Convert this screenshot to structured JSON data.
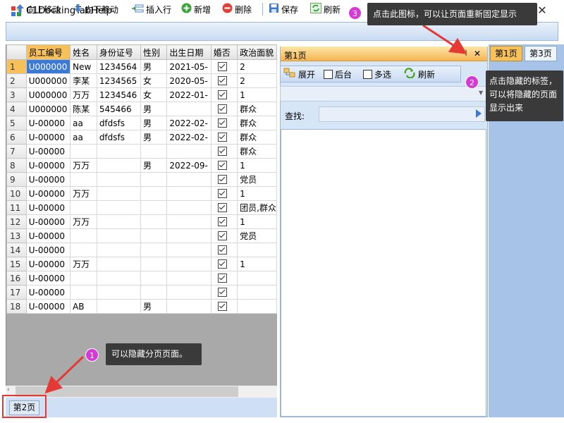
{
  "window": {
    "title": "C1DockingTabHelp"
  },
  "toolbar": {
    "items": [
      {
        "label": "向上移动",
        "icon": "arrow-up-icon"
      },
      {
        "label": "向下移动",
        "icon": "arrow-down-icon"
      },
      {
        "label": "插入行",
        "icon": "insert-row-icon"
      },
      {
        "label": "新增",
        "icon": "add-icon"
      },
      {
        "label": "删除",
        "icon": "delete-icon"
      },
      {
        "label": "保存",
        "icon": "save-icon"
      },
      {
        "label": "刷新",
        "icon": "refresh-icon"
      }
    ]
  },
  "grid": {
    "columns": [
      "员工编号",
      "姓名",
      "身份证号",
      "性别",
      "出生日期",
      "婚否",
      "政治面貌"
    ],
    "rows": [
      {
        "n": "1",
        "id": "U000000",
        "name": "New",
        "idcard": "1234564",
        "gender": "男",
        "birth": "2021-05-",
        "married": true,
        "political": "2"
      },
      {
        "n": "2",
        "id": "U000000",
        "name": "李某",
        "idcard": "1234565",
        "gender": "女",
        "birth": "2020-05-",
        "married": true,
        "political": "2"
      },
      {
        "n": "3",
        "id": "U000000",
        "name": "万万",
        "idcard": "1234546",
        "gender": "女",
        "birth": "2022-01-",
        "married": true,
        "political": "1"
      },
      {
        "n": "4",
        "id": "U000000",
        "name": "陈某",
        "idcard": "545466",
        "gender": "男",
        "birth": "",
        "married": true,
        "political": "群众"
      },
      {
        "n": "5",
        "id": "U-00000",
        "name": "aa",
        "idcard": "dfdsfs",
        "gender": "男",
        "birth": "2022-02-",
        "married": true,
        "political": "群众"
      },
      {
        "n": "6",
        "id": "U-00000",
        "name": "aa",
        "idcard": "dfdsfs",
        "gender": "男",
        "birth": "2022-02-",
        "married": true,
        "political": "群众"
      },
      {
        "n": "7",
        "id": "U-00000",
        "name": "",
        "idcard": "",
        "gender": "",
        "birth": "",
        "married": true,
        "political": "群众"
      },
      {
        "n": "8",
        "id": "U-00000",
        "name": "万万",
        "idcard": "",
        "gender": "男",
        "birth": "2022-09-",
        "married": true,
        "political": "1"
      },
      {
        "n": "9",
        "id": "U-00000",
        "name": "",
        "idcard": "",
        "gender": "",
        "birth": "",
        "married": true,
        "political": "党员"
      },
      {
        "n": "10",
        "id": "U-00000",
        "name": "万万",
        "idcard": "",
        "gender": "",
        "birth": "",
        "married": true,
        "political": "1"
      },
      {
        "n": "11",
        "id": "U-00000",
        "name": "",
        "idcard": "",
        "gender": "",
        "birth": "",
        "married": true,
        "political": "团员,群众"
      },
      {
        "n": "12",
        "id": "U-00000",
        "name": "万万",
        "idcard": "",
        "gender": "",
        "birth": "",
        "married": true,
        "political": "1"
      },
      {
        "n": "13",
        "id": "U-00000",
        "name": "",
        "idcard": "",
        "gender": "",
        "birth": "",
        "married": true,
        "political": "党员"
      },
      {
        "n": "14",
        "id": "U-00000",
        "name": "",
        "idcard": "",
        "gender": "",
        "birth": "",
        "married": true,
        "political": ""
      },
      {
        "n": "15",
        "id": "U-00000",
        "name": "万万",
        "idcard": "",
        "gender": "",
        "birth": "",
        "married": true,
        "political": "1"
      },
      {
        "n": "16",
        "id": "U-00000",
        "name": "",
        "idcard": "",
        "gender": "",
        "birth": "",
        "married": true,
        "political": ""
      },
      {
        "n": "17",
        "id": "U-00000",
        "name": "",
        "idcard": "",
        "gender": "",
        "birth": "",
        "married": true,
        "political": ""
      },
      {
        "n": "18",
        "id": "U-00000",
        "name": "AB",
        "idcard": "",
        "gender": "男",
        "birth": "",
        "married": true,
        "political": ""
      }
    ]
  },
  "bottom_tab": {
    "label": "第2页"
  },
  "dock": {
    "caption": "第1页",
    "pin_glyph": "⊣",
    "close_glyph": "✕",
    "toolbar": {
      "expand_label": "展开",
      "background_label": "后台",
      "multiselect_label": "多选",
      "refresh_label": "刷新"
    },
    "find_label": "查找:"
  },
  "right_tabs": [
    {
      "label": "第1页",
      "active": true
    },
    {
      "label": "第3页",
      "active": false
    }
  ],
  "annotations": {
    "a1": {
      "num": "1",
      "text": "可以隐藏分页页面。"
    },
    "a2": {
      "num": "2",
      "text": "点击隐藏的标签，可以将隐藏的页面显示出来"
    },
    "a3": {
      "num": "3",
      "text": "点击此图标，可以让页面重新固定显示"
    }
  },
  "colors": {
    "accent_orange": "#f7c15a",
    "annotation_red": "#e53935",
    "badge_magenta": "#d63ad6",
    "selection_blue": "#3b7ad9"
  }
}
